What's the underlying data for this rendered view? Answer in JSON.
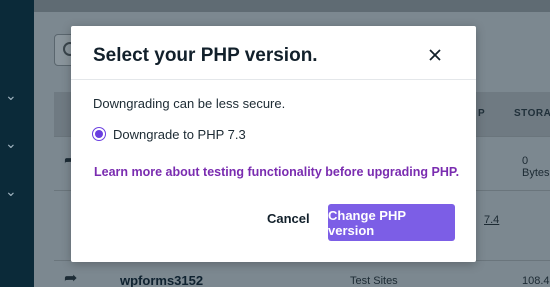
{
  "background": {
    "table_headers": {
      "php": "P",
      "storage": "STORA"
    },
    "rows": [
      {
        "storage": "0 Bytes"
      },
      {
        "php_version": "7.4"
      },
      {
        "site_name": "wpforms3152",
        "type": "Test Sites",
        "storage": "108.4"
      }
    ]
  },
  "modal": {
    "title": "Select your PHP version.",
    "close_icon": "close-icon",
    "warning_text": "Downgrading can be less secure.",
    "option_label": "Downgrade to PHP 7.3",
    "option_selected": true,
    "learn_more_link": "Learn more about testing functionality before upgrading PHP.",
    "cancel_label": "Cancel",
    "confirm_label": "Change PHP version",
    "accent_color": "#7c5ee6",
    "link_color": "#7a2cb0"
  }
}
